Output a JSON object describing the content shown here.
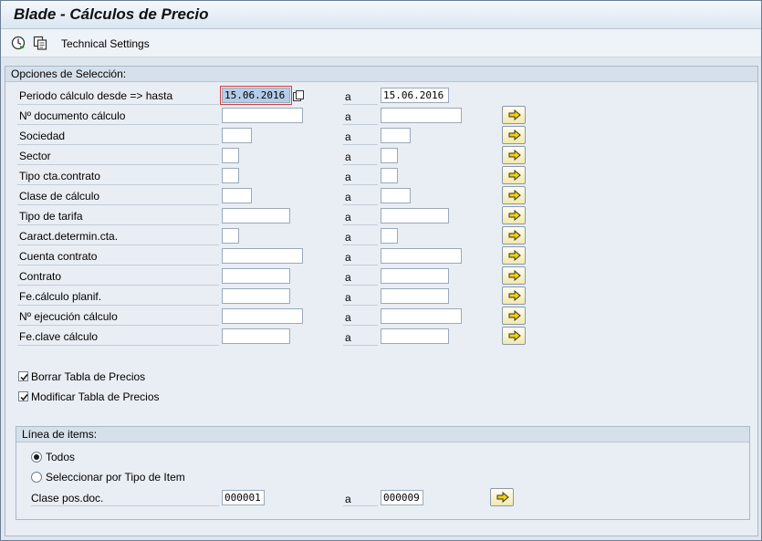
{
  "window": {
    "title": "Blade - Cálculos de Precio"
  },
  "toolbar": {
    "technical_settings": "Technical Settings"
  },
  "selection": {
    "title": "Opciones de Selección:",
    "to_label": "a",
    "rows": [
      {
        "label": "Periodo cálculo desde => hasta",
        "from": "15.06.2016",
        "to": "15.06.2016"
      },
      {
        "label": "Nº documento cálculo",
        "from": "",
        "to": ""
      },
      {
        "label": "Sociedad",
        "from": "",
        "to": ""
      },
      {
        "label": "Sector",
        "from": "",
        "to": ""
      },
      {
        "label": "Tipo cta.contrato",
        "from": "",
        "to": ""
      },
      {
        "label": "Clase de cálculo",
        "from": "",
        "to": ""
      },
      {
        "label": "Tipo de tarifa",
        "from": "",
        "to": ""
      },
      {
        "label": "Caract.determin.cta.",
        "from": "",
        "to": ""
      },
      {
        "label": "Cuenta contrato",
        "from": "",
        "to": ""
      },
      {
        "label": "Contrato",
        "from": "",
        "to": ""
      },
      {
        "label": "Fe.cálculo planif.",
        "from": "",
        "to": ""
      },
      {
        "label": "Nº ejecución cálculo",
        "from": "",
        "to": ""
      },
      {
        "label": "Fe.clave cálculo",
        "from": "",
        "to": ""
      }
    ]
  },
  "options": {
    "borrar_label": "Borrar Tabla de Precios",
    "borrar_checked": true,
    "modificar_label": "Modificar Tabla de Precios",
    "modificar_checked": true
  },
  "items": {
    "title": "Línea de items:",
    "radio_todos": "Todos",
    "radio_tipo": "Seleccionar por Tipo de Item",
    "selected": "todos",
    "clase_label": "Clase pos.doc.",
    "to_label": "a",
    "clase_from": "000001",
    "clase_to": "000009"
  },
  "colors": {
    "accent": "#f2e8b0",
    "active_field": "#b3cde8"
  }
}
